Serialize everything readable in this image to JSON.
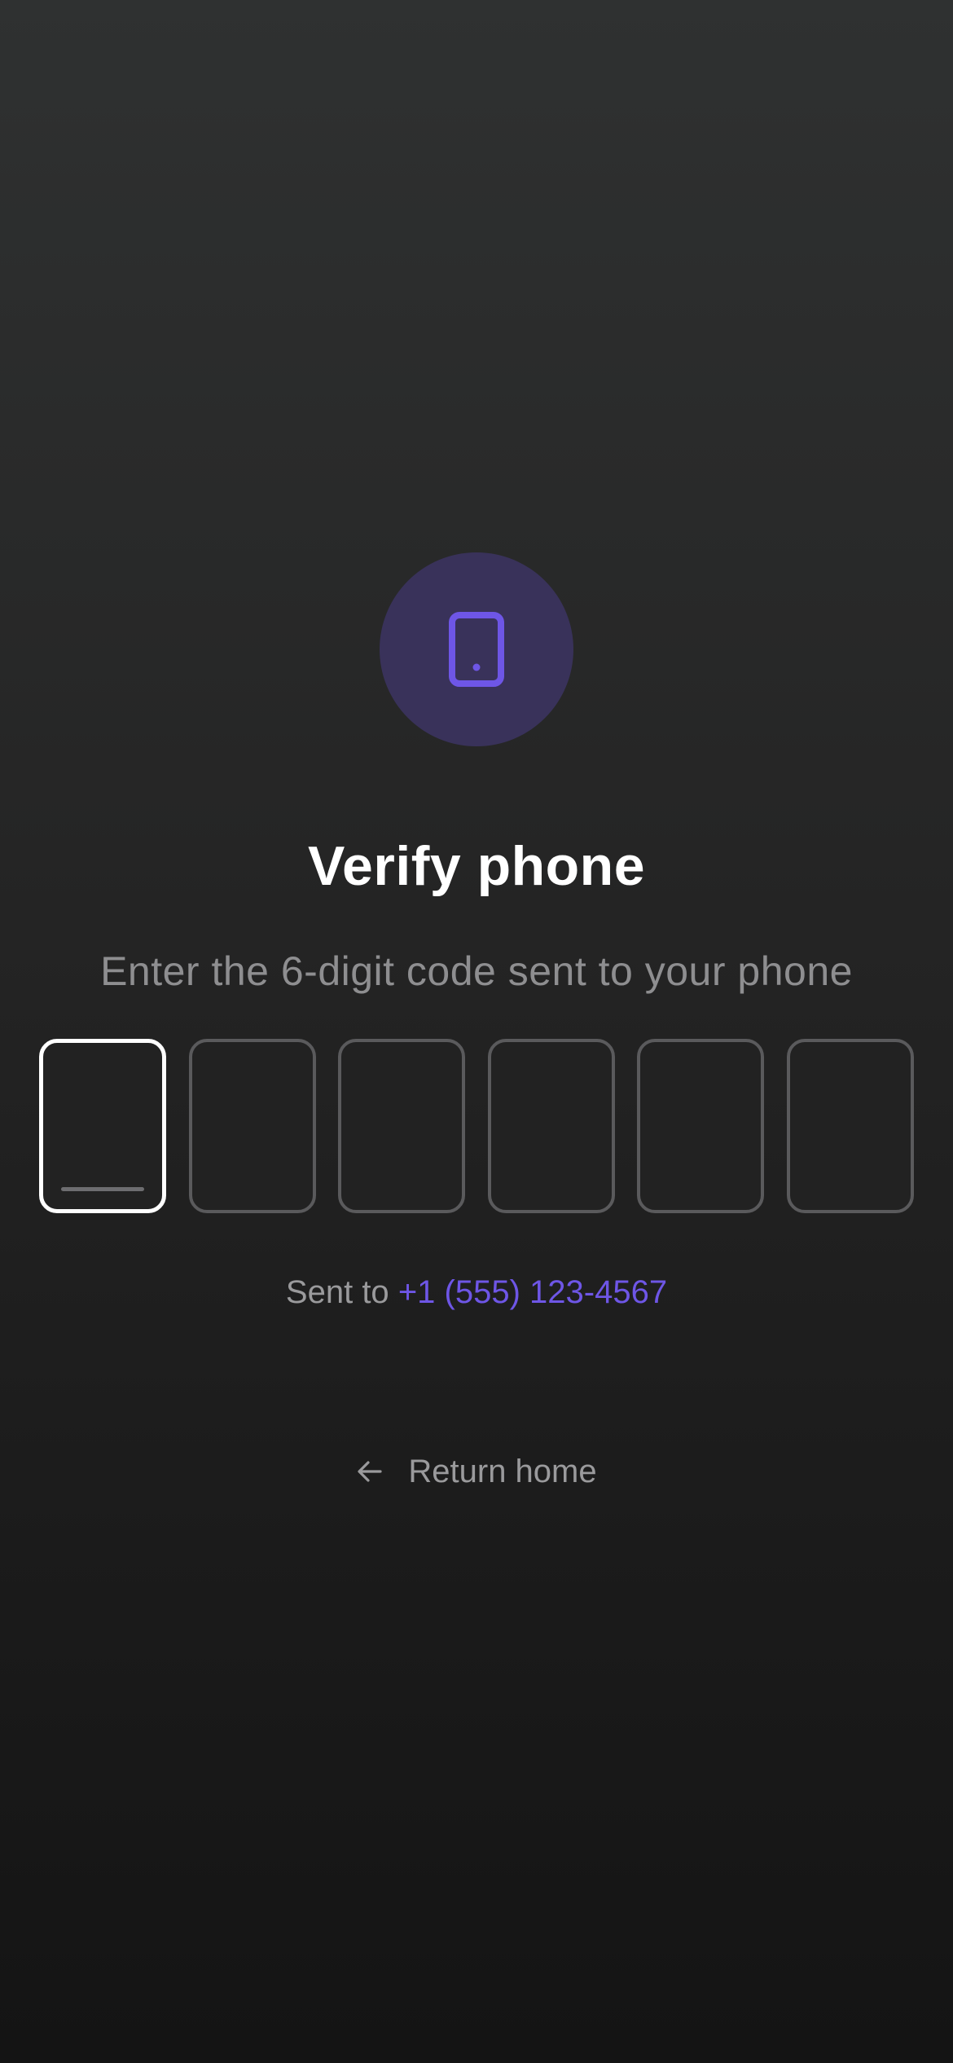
{
  "colors": {
    "accent": "#6e56e6",
    "icon_circle_bg": "#39325a",
    "text_primary": "#ffffff",
    "text_secondary": "#8e8e90",
    "box_border": "#5a5a5c",
    "box_border_active": "#ffffff"
  },
  "header": {
    "icon": "phone-icon",
    "title": "Verify phone",
    "subtitle": "Enter the 6-digit code sent to your phone"
  },
  "code": {
    "length": 6,
    "digits": [
      "",
      "",
      "",
      "",
      "",
      ""
    ],
    "active_index": 0
  },
  "sent_to": {
    "prefix": "Sent to",
    "phone": "+1 (555) 123-4567"
  },
  "return_home": {
    "icon": "arrow-left-icon",
    "label": "Return home"
  }
}
